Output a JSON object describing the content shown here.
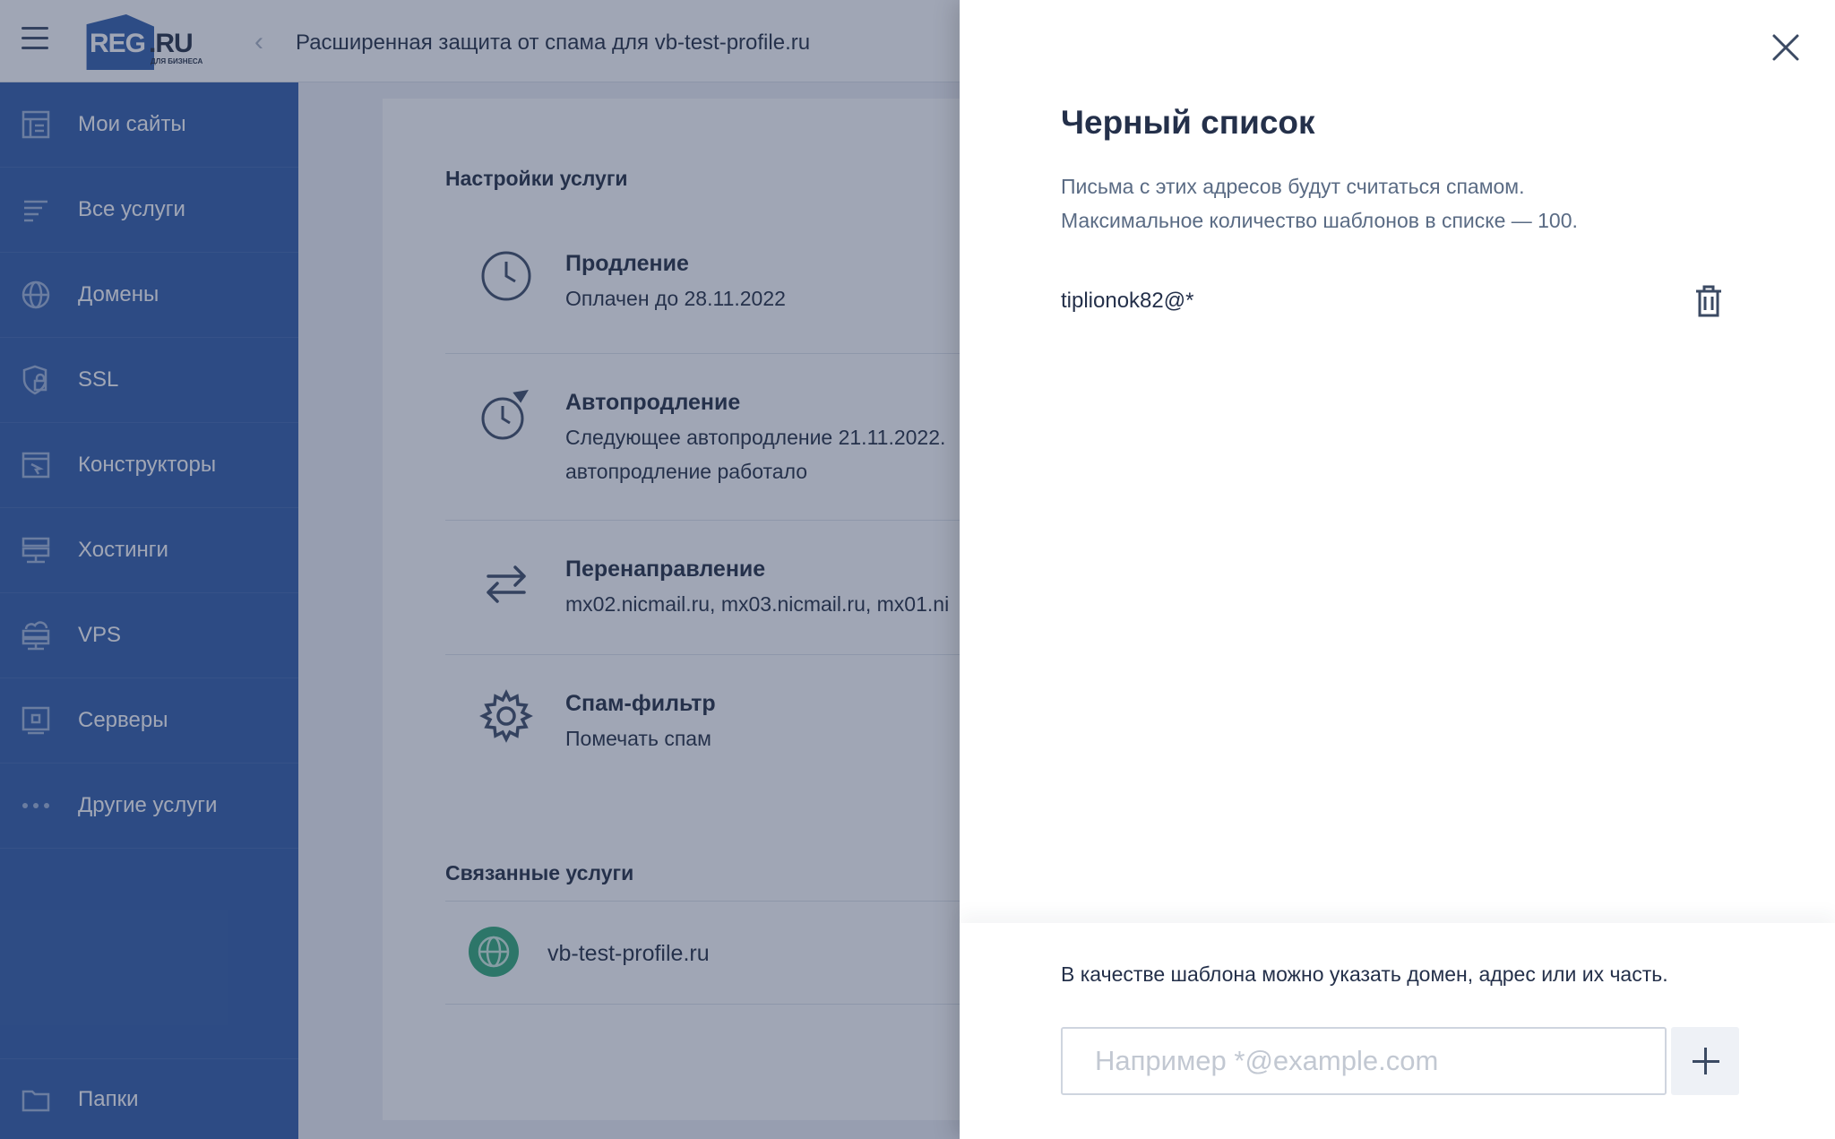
{
  "header": {
    "logo_reg": "REG",
    "logo_ru": ".RU",
    "logo_sub": "ДЛЯ БИЗНЕСА",
    "title": "Расширенная защита от спама для vb-test-profile.ru"
  },
  "sidebar": {
    "items": [
      {
        "label": "Мои сайты",
        "icon": "sites-icon"
      },
      {
        "label": "Все услуги",
        "icon": "list-icon"
      },
      {
        "label": "Домены",
        "icon": "globe-icon"
      },
      {
        "label": "SSL",
        "icon": "ssl-lock-icon"
      },
      {
        "label": "Конструкторы",
        "icon": "builder-icon"
      },
      {
        "label": "Хостинги",
        "icon": "hosting-icon"
      },
      {
        "label": "VPS",
        "icon": "vps-icon"
      },
      {
        "label": "Серверы",
        "icon": "server-icon"
      },
      {
        "label": "Другие услуги",
        "icon": "dots-icon"
      }
    ],
    "footer_item": {
      "label": "Папки",
      "icon": "folder-icon"
    }
  },
  "settings": {
    "section_title": "Настройки услуги",
    "rows": [
      {
        "title": "Продление",
        "lines": [
          "Оплачен до 28.11.2022"
        ],
        "icon": "clock-icon"
      },
      {
        "title": "Автопродление",
        "lines": [
          "Следующее автопродление 21.11.2022.",
          "автопродление работало"
        ],
        "icon": "autorenew-clock-icon"
      },
      {
        "title": "Перенаправление",
        "lines": [
          "mx02.nicmail.ru, mx03.nicmail.ru, mx01.ni"
        ],
        "icon": "redirect-arrows-icon"
      },
      {
        "title": "Спам-фильтр",
        "lines": [
          "Помечать спам"
        ],
        "icon": "gear-icon"
      }
    ]
  },
  "linked": {
    "section_title": "Связанные услуги",
    "domain": "vb-test-profile.ru"
  },
  "drawer": {
    "title": "Черный список",
    "description_lines": [
      "Письма с этих адресов будут считаться спамом.",
      "Максимальное количество шаблонов в списке — 100."
    ],
    "entries": [
      "tiplionok82@*"
    ],
    "hint": "В качестве шаблона можно указать домен, адрес или их часть.",
    "input_placeholder": "Например *@example.com",
    "input_value": ""
  }
}
